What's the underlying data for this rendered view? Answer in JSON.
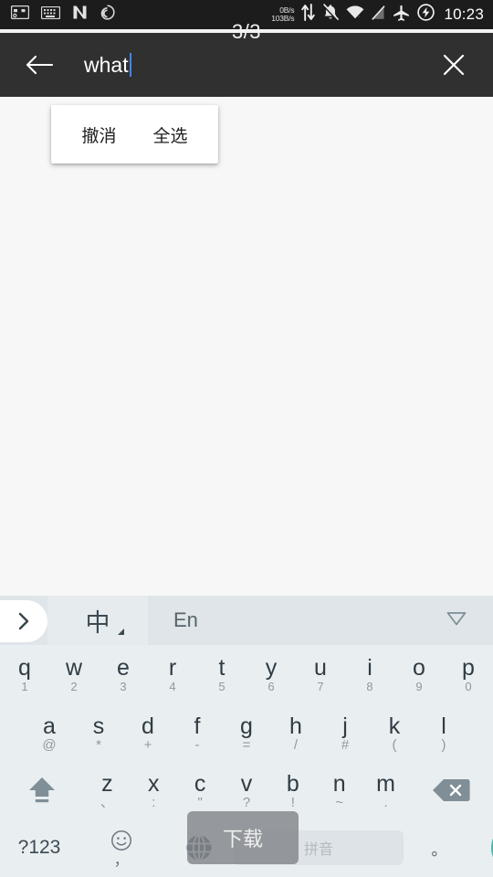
{
  "status_bar": {
    "left_icons": [
      {
        "name": "sim-card-icon",
        "glyph": "sim"
      },
      {
        "name": "keyboard-icon",
        "glyph": "keyboard"
      },
      {
        "name": "nova-launcher-icon",
        "glyph": "N"
      },
      {
        "name": "spiral-app-icon",
        "glyph": "spiral"
      }
    ],
    "network_speed_up": "0B/s",
    "network_speed_down": "103B/s",
    "right_icons": [
      {
        "name": "data-transfer-icon",
        "glyph": "up-down-arrows"
      },
      {
        "name": "notifications-muted-icon",
        "glyph": "bell-slash"
      },
      {
        "name": "wifi-icon",
        "glyph": "wifi"
      },
      {
        "name": "signal-off-icon",
        "glyph": "signal-slash"
      },
      {
        "name": "airplane-mode-icon",
        "glyph": "airplane"
      },
      {
        "name": "battery-charging-icon",
        "glyph": "bolt-circle"
      }
    ],
    "clock": "10:23"
  },
  "page_counter": "3/3",
  "app_bar": {
    "back_label": "back-arrow",
    "search_value": "what",
    "search_placeholder": "",
    "clear_label": "close"
  },
  "edit_popup": {
    "items": [
      {
        "label": "撤消",
        "name": "undo"
      },
      {
        "label": "全选",
        "name": "select-all"
      }
    ]
  },
  "keyboard": {
    "toolbar": {
      "expand_label": "›",
      "language_chinese": "中",
      "language_english": "En",
      "dropdown_label": "▽"
    },
    "row1": [
      {
        "main": "q",
        "sub": "1"
      },
      {
        "main": "w",
        "sub": "2"
      },
      {
        "main": "e",
        "sub": "3"
      },
      {
        "main": "r",
        "sub": "4"
      },
      {
        "main": "t",
        "sub": "5"
      },
      {
        "main": "y",
        "sub": "6"
      },
      {
        "main": "u",
        "sub": "7"
      },
      {
        "main": "i",
        "sub": "8"
      },
      {
        "main": "o",
        "sub": "9"
      },
      {
        "main": "p",
        "sub": "0"
      }
    ],
    "row2": [
      {
        "main": "a",
        "sub": "@"
      },
      {
        "main": "s",
        "sub": "*"
      },
      {
        "main": "d",
        "sub": "+"
      },
      {
        "main": "f",
        "sub": "-"
      },
      {
        "main": "g",
        "sub": "="
      },
      {
        "main": "h",
        "sub": "/"
      },
      {
        "main": "j",
        "sub": "#"
      },
      {
        "main": "k",
        "sub": "("
      },
      {
        "main": "l",
        "sub": ")"
      }
    ],
    "row3": [
      {
        "main": "z",
        "sub": "、"
      },
      {
        "main": "x",
        "sub": ":"
      },
      {
        "main": "c",
        "sub": "\""
      },
      {
        "main": "v",
        "sub": "?"
      },
      {
        "main": "b",
        "sub": "!"
      },
      {
        "main": "n",
        "sub": "~"
      },
      {
        "main": "m",
        "sub": "."
      }
    ],
    "shift_label": "shift",
    "backspace_label": "backspace",
    "row4": {
      "symbols_label": "?123",
      "emoji_sub": "，",
      "globe_label": "globe",
      "space_label": "拼音",
      "period_label": "。",
      "search_label": "search"
    }
  },
  "toast": {
    "text": "下载"
  },
  "colors": {
    "status_bar_bg": "#1c1c1c",
    "app_bar_bg": "#303030",
    "content_bg": "#f7f7f7",
    "keyboard_bg": "#e9eef0",
    "keyboard_toolbar_bg": "#dfe5e8",
    "accent_search": "#4db6ac",
    "caret": "#4285f4",
    "key_text": "#2f3c44",
    "key_sub_text": "#8d9aa2"
  }
}
